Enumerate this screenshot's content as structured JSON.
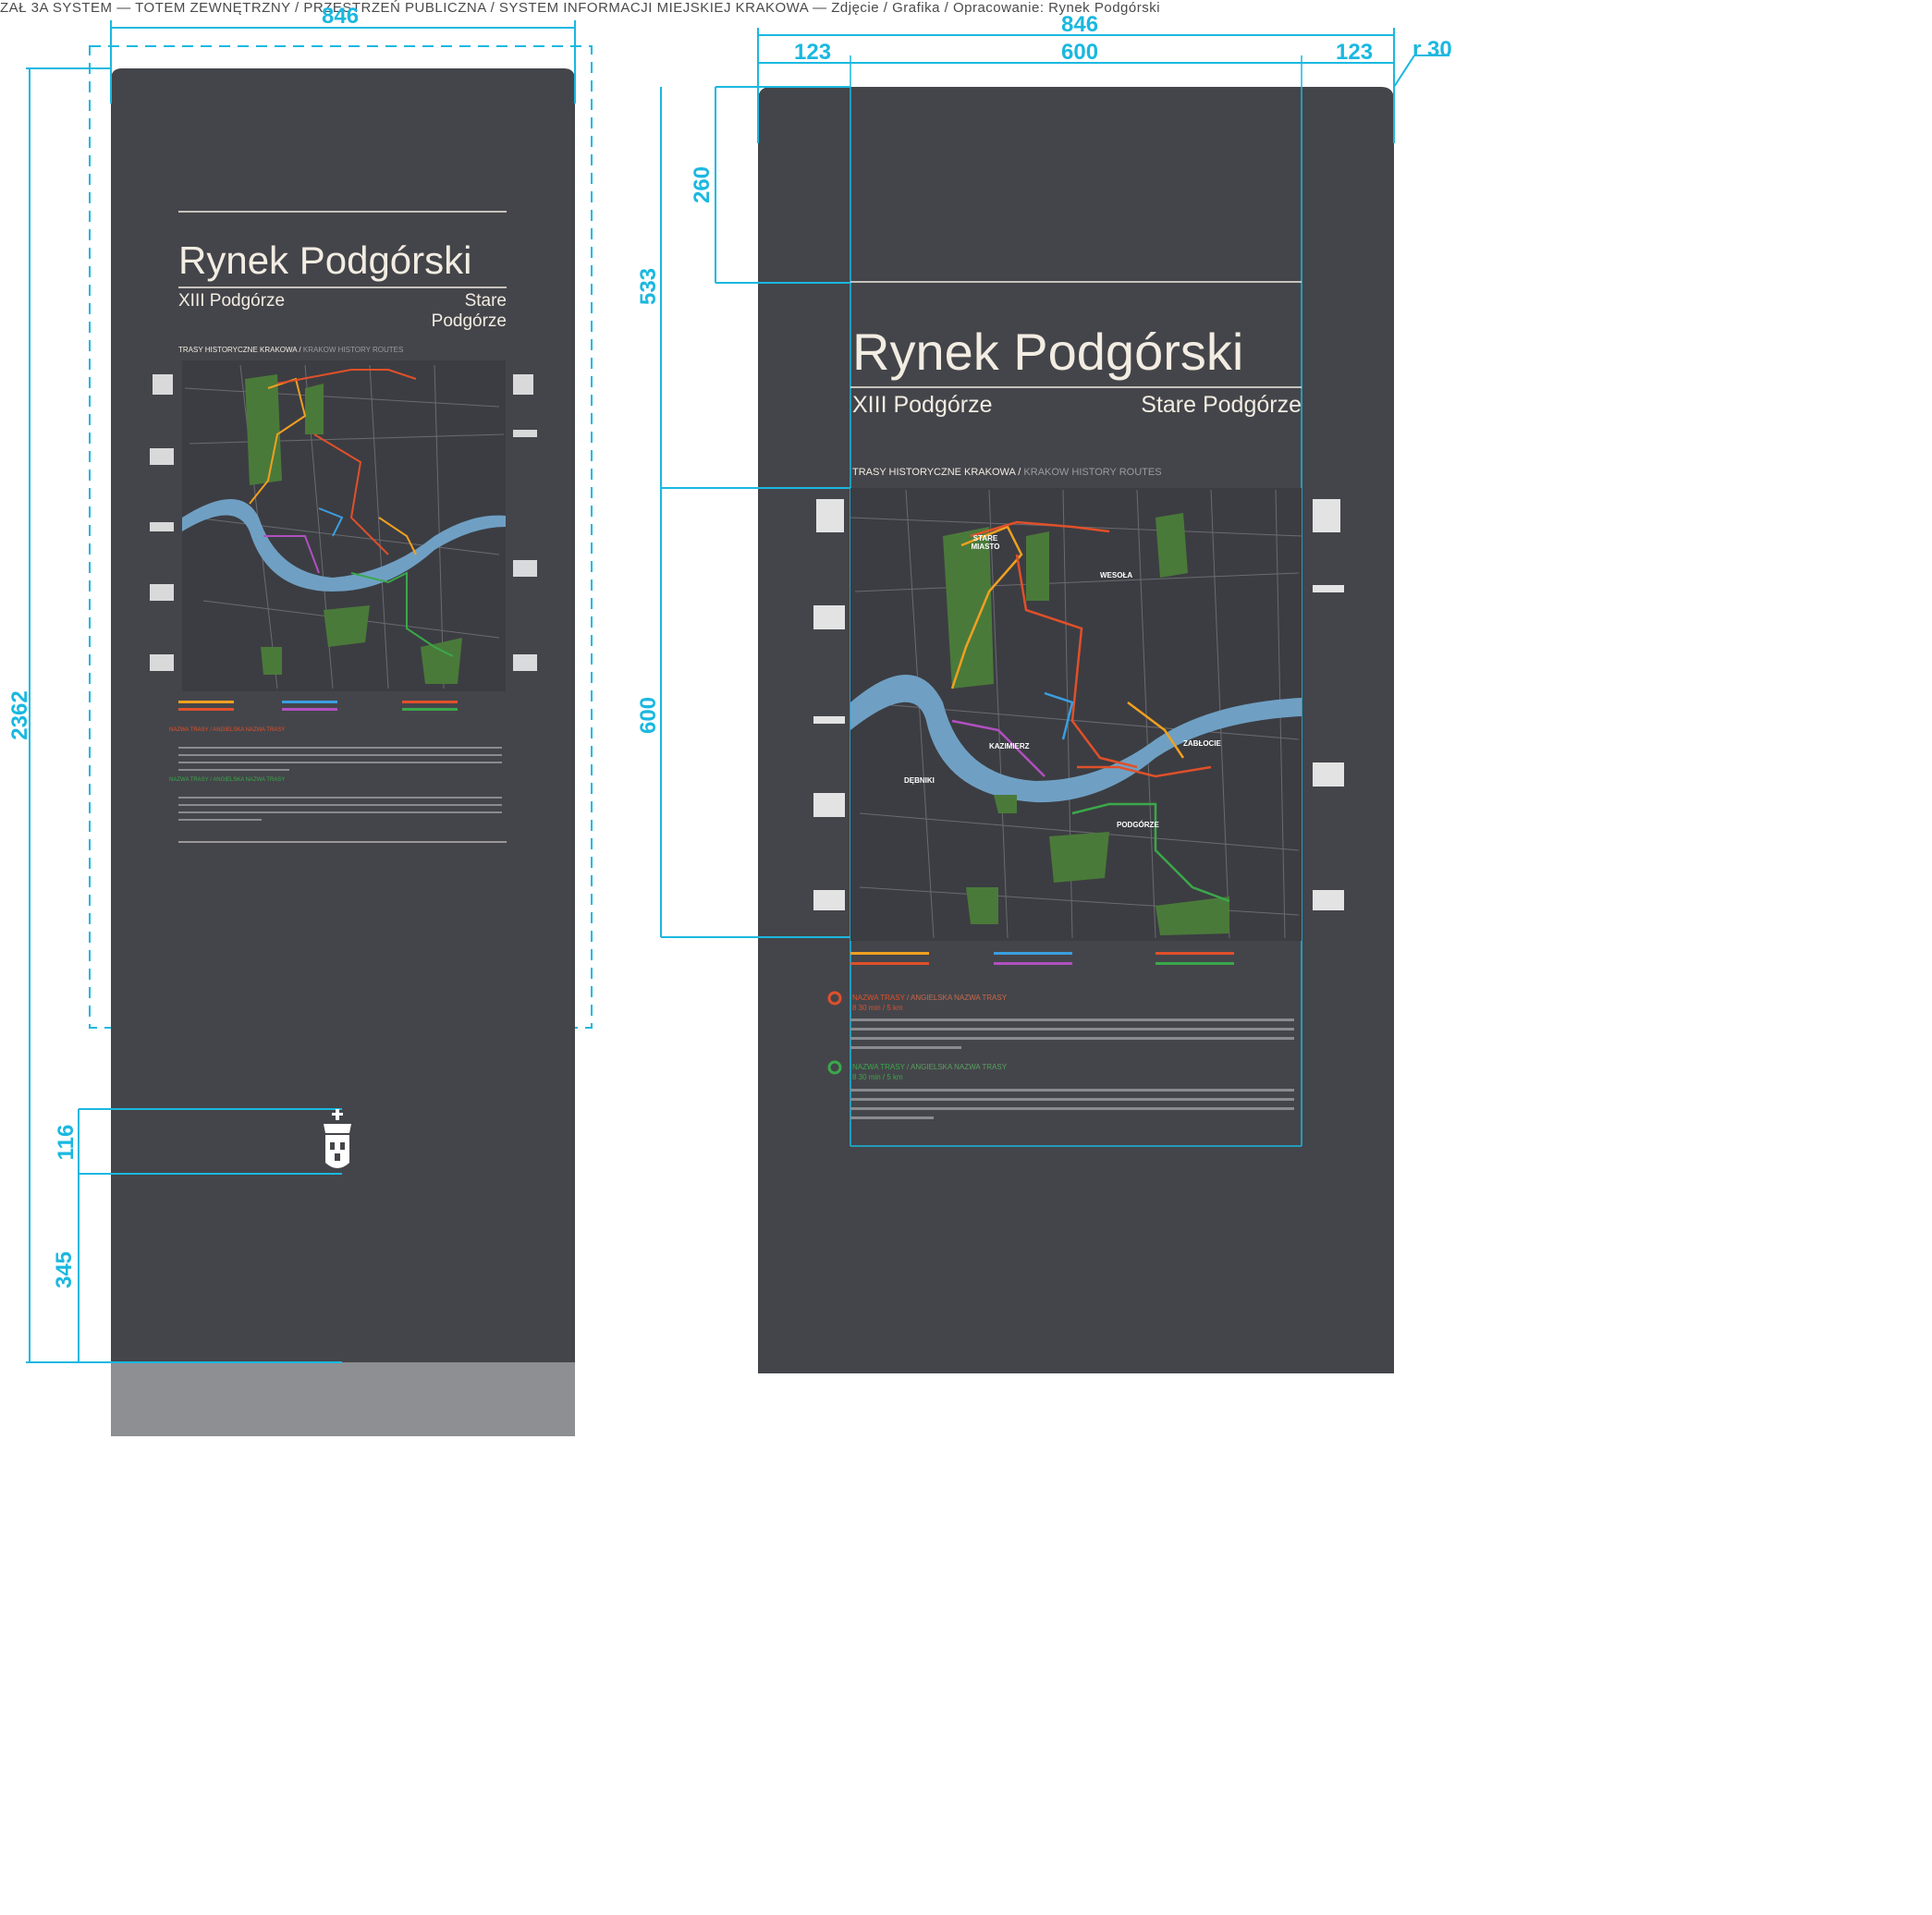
{
  "header": {
    "text": "ZAŁ 3A SYSTEM — TOTEM ZEWNĘTRZNY / PRZESTRZEŃ PUBLICZNA / SYSTEM INFORMACJI MIEJSKIEJ KRAKOWA — Zdjęcie / Grafika / Opracowanie: Rynek Podgórski"
  },
  "colors": {
    "panel": "#44454a",
    "base": "#8e8f93",
    "dimension": "#1ab8e0",
    "cream": "#f2ece2",
    "river": "#6fa0c4",
    "park": "#4a7a3a",
    "route_red": "#e0502a",
    "route_orange": "#f0a020",
    "route_yellow": "#e8d040",
    "route_green": "#3aa84a",
    "route_purple": "#b050c0",
    "route_blue": "#3a9ee0"
  },
  "sign": {
    "title": "Rynek Podgórski",
    "district": "XIII Podgórze",
    "area": "Stare Podgórze",
    "routes_heading": "TRASY HISTORYCZNE KRAKOWA /",
    "routes_heading_en": "KRAKOW HISTORY ROUTES",
    "map_labels": [
      "STARE MIASTO",
      "WESOŁA",
      "KAZIMIERZ",
      "ZABŁOCIE",
      "DĘBNIKI",
      "PODGÓRZE"
    ],
    "route1_title": "NAZWA TRASY",
    "route1_title_en": "/ ANGIELSKA NAZWA TRASY",
    "route1_meta": "8 30 min / 5 km",
    "route2_title": "NAZWA TRASY",
    "route2_title_en": "/ ANGIELSKA NAZWA TRASY",
    "route2_meta": "8 30 min / 5 km"
  },
  "dimensions": {
    "left_total_width": "846",
    "left_total_height": "2362",
    "left_crest_height": "116",
    "left_crest_bottom": "345",
    "right_total_width": "846",
    "right_margin_left": "123",
    "right_content_width": "600",
    "right_margin_right": "123",
    "right_radius": "r 30",
    "right_top_to_rule": "260",
    "right_top_to_map": "533",
    "right_map_height": "600"
  }
}
